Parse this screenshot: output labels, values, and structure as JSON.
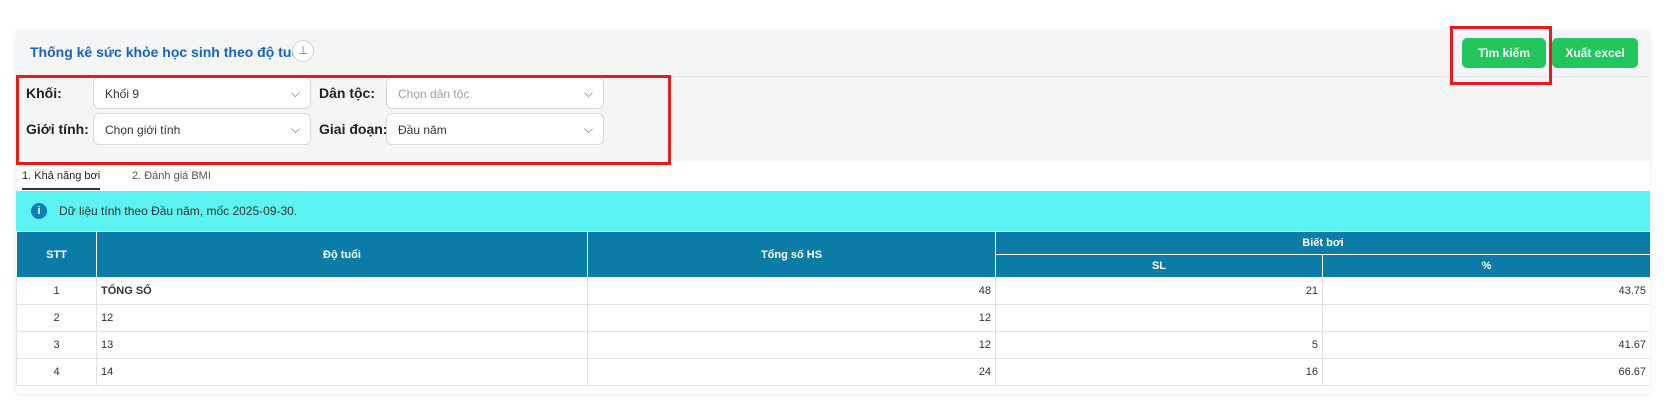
{
  "header": {
    "title": "Thống kê sức khỏe học sinh theo độ tuổi",
    "pin_icon": "pin-icon",
    "search_label": "Tìm kiếm",
    "excel_label": "Xuất excel"
  },
  "filters": {
    "grade": {
      "label": "Khối:",
      "value": "Khối 9"
    },
    "ethnicity": {
      "label": "Dân tộc:",
      "placeholder": "Chọn dân tộc"
    },
    "gender": {
      "label": "Giới tính:",
      "placeholder": "Chọn giới tính"
    },
    "stage": {
      "label": "Giai đoạn:",
      "value": "Đầu năm"
    },
    "chevron": "⌵"
  },
  "tabs": [
    {
      "label": "1. Khả năng bơi",
      "active": true
    },
    {
      "label": "2. Đánh giá BMI",
      "active": false
    }
  ],
  "info": {
    "icon": "info-icon",
    "text": "Dữ liệu tính theo Đầu năm, mốc 2025-09-30."
  },
  "table": {
    "headers": {
      "stt": "STT",
      "age": "Độ tuổi",
      "total": "Tổng số HS",
      "swim": "Biết bơi",
      "sl": "SL",
      "pct": "%"
    },
    "rows": [
      {
        "stt": "1",
        "age": "TỔNG SỐ",
        "total": "48",
        "sl": "21",
        "pct": "43.75"
      },
      {
        "stt": "2",
        "age": "12",
        "total": "12",
        "sl": "",
        "pct": ""
      },
      {
        "stt": "3",
        "age": "13",
        "total": "12",
        "sl": "5",
        "pct": "41.67"
      },
      {
        "stt": "4",
        "age": "14",
        "total": "24",
        "sl": "16",
        "pct": "66.67"
      }
    ]
  },
  "colors": {
    "accent": "#22c55e",
    "title": "#1565c0",
    "table_header": "#0b7ca8",
    "info_bg": "#5df2f2",
    "highlight": "#e41c1c"
  }
}
